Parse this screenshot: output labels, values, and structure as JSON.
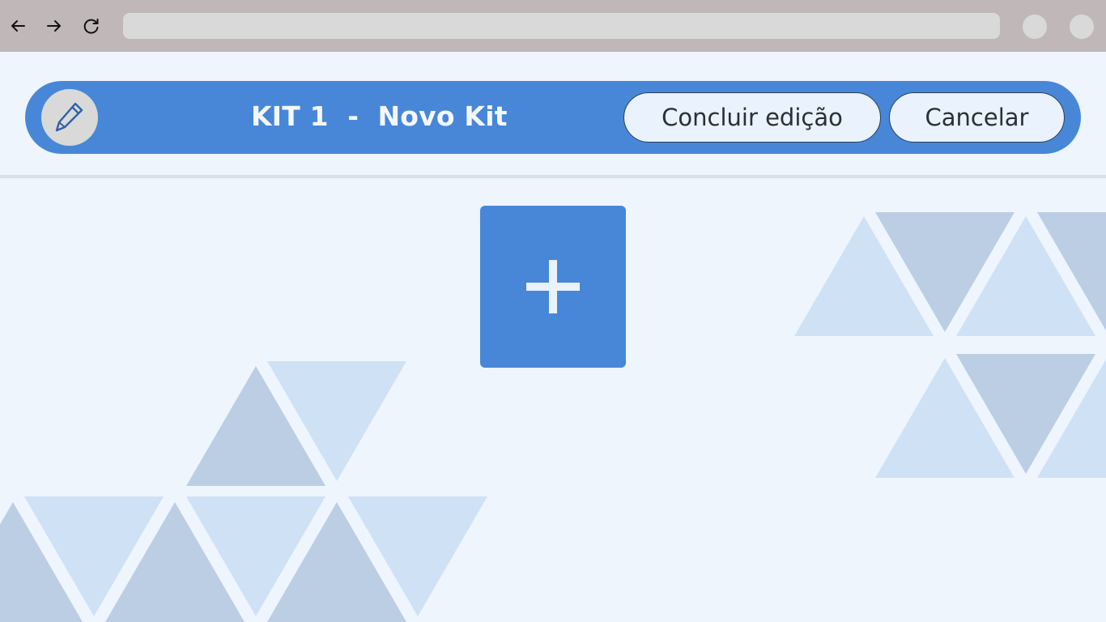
{
  "browser": {
    "back_icon": "arrow-left-icon",
    "forward_icon": "arrow-right-icon",
    "reload_icon": "reload-icon",
    "address": ""
  },
  "header": {
    "edit_icon": "pencil-icon",
    "title": "KIT 1  -  Novo Kit",
    "finish_label": "Concluir edição",
    "cancel_label": "Cancelar"
  },
  "main": {
    "add_icon": "plus-icon"
  },
  "colors": {
    "accent": "#4887d8",
    "background": "#eef5fd",
    "triangle_light": "#cfe1f5",
    "triangle_dark": "#bccee3"
  }
}
